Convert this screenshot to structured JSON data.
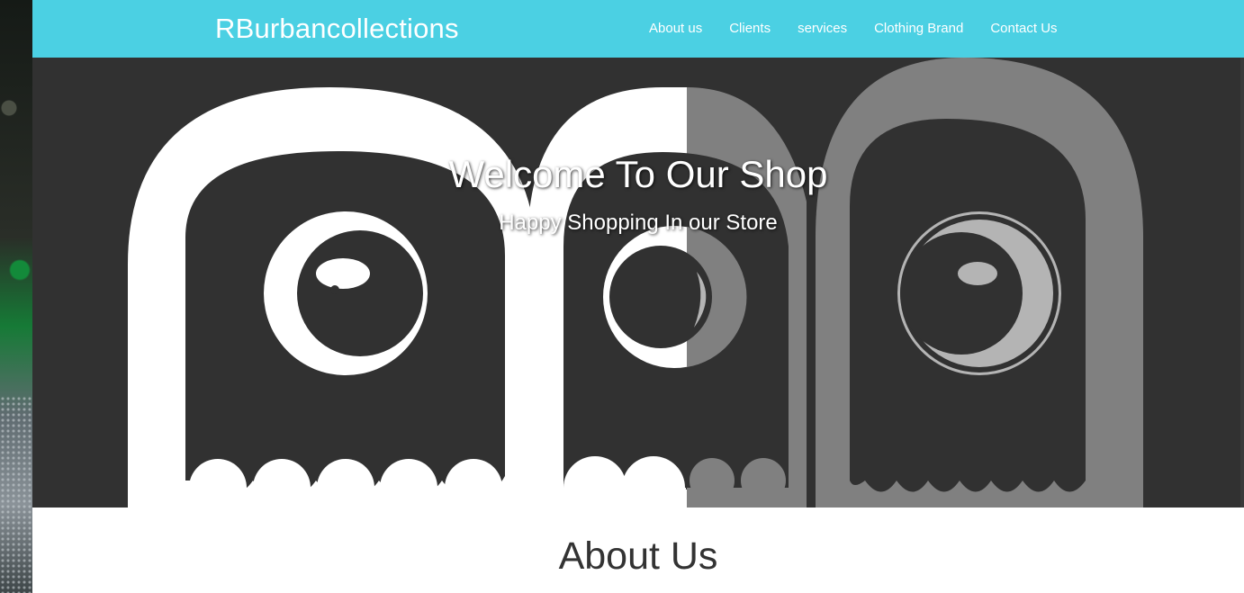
{
  "header": {
    "brand": "RBurbancollections",
    "nav": [
      "About us",
      "Clients",
      "services",
      "Clothing Brand",
      "Contact Us"
    ]
  },
  "hero": {
    "title": "Welcome To Our Shop",
    "subtitle": "Happy Shopping In our Store"
  },
  "about": {
    "title": "About Us"
  },
  "colors": {
    "navbar": "#4bd0e3",
    "hero_bg": "#313131",
    "ghost_white": "#ffffff",
    "ghost_gray": "#808080",
    "eye_gray": "#b4b4b4"
  }
}
